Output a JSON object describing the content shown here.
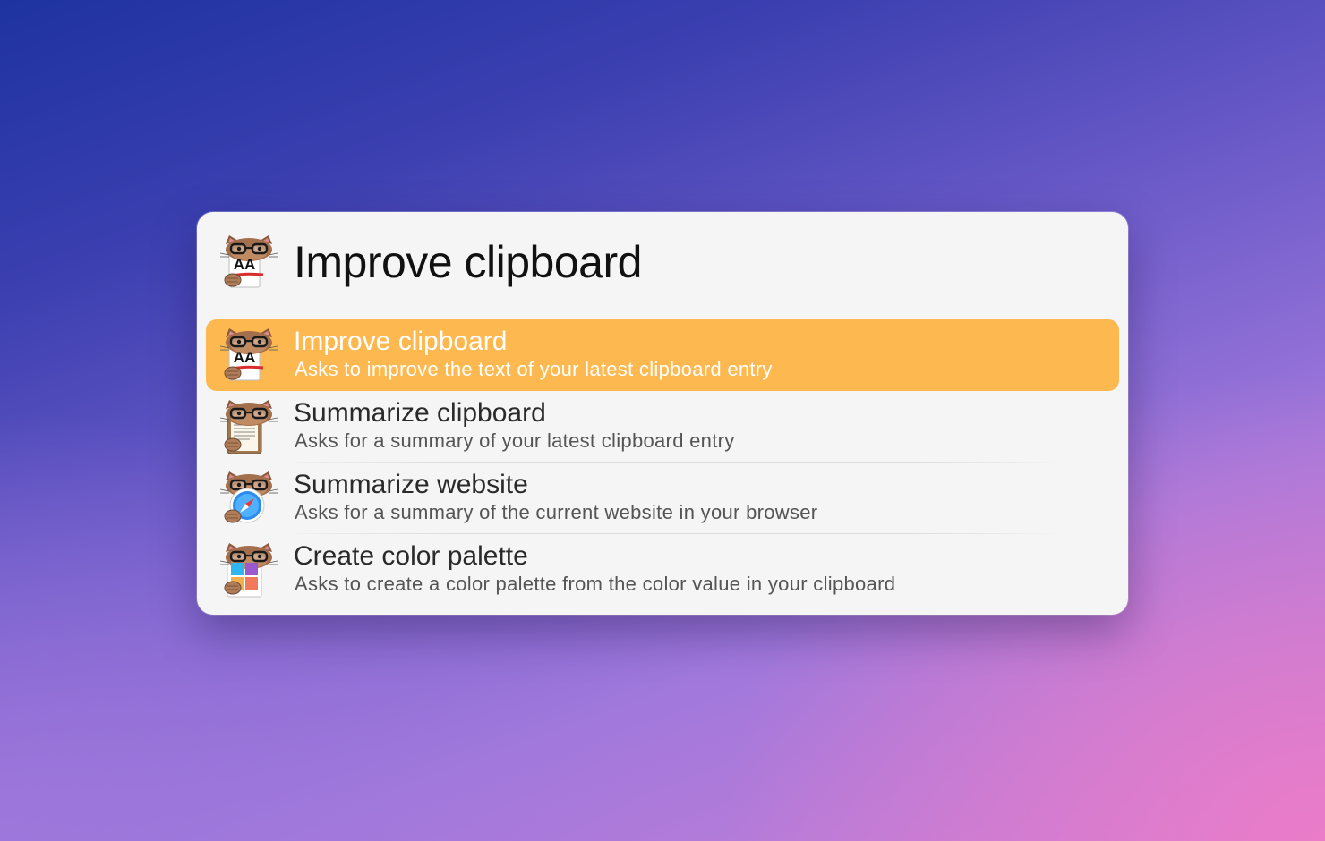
{
  "search": {
    "query": "Improve clipboard",
    "icon": "improve-clipboard-icon"
  },
  "results": [
    {
      "title": "Improve clipboard",
      "subtitle": "Asks to improve the text of your latest clipboard entry",
      "icon": "improve-clipboard-icon",
      "selected": true
    },
    {
      "title": "Summarize clipboard",
      "subtitle": "Asks for a summary of your latest clipboard entry",
      "icon": "summarize-clipboard-icon",
      "selected": false
    },
    {
      "title": "Summarize website",
      "subtitle": "Asks for a summary of the current website in your browser",
      "icon": "summarize-website-icon",
      "selected": false
    },
    {
      "title": "Create color palette",
      "subtitle": "Asks to create a color palette from the color value in your clipboard",
      "icon": "color-palette-icon",
      "selected": false
    }
  ],
  "icons": {
    "improve_clipboard_text": "AA"
  },
  "colors": {
    "selection": "#fdb94f",
    "window": "#f5f5f5",
    "selected_text": "#ffffff"
  }
}
